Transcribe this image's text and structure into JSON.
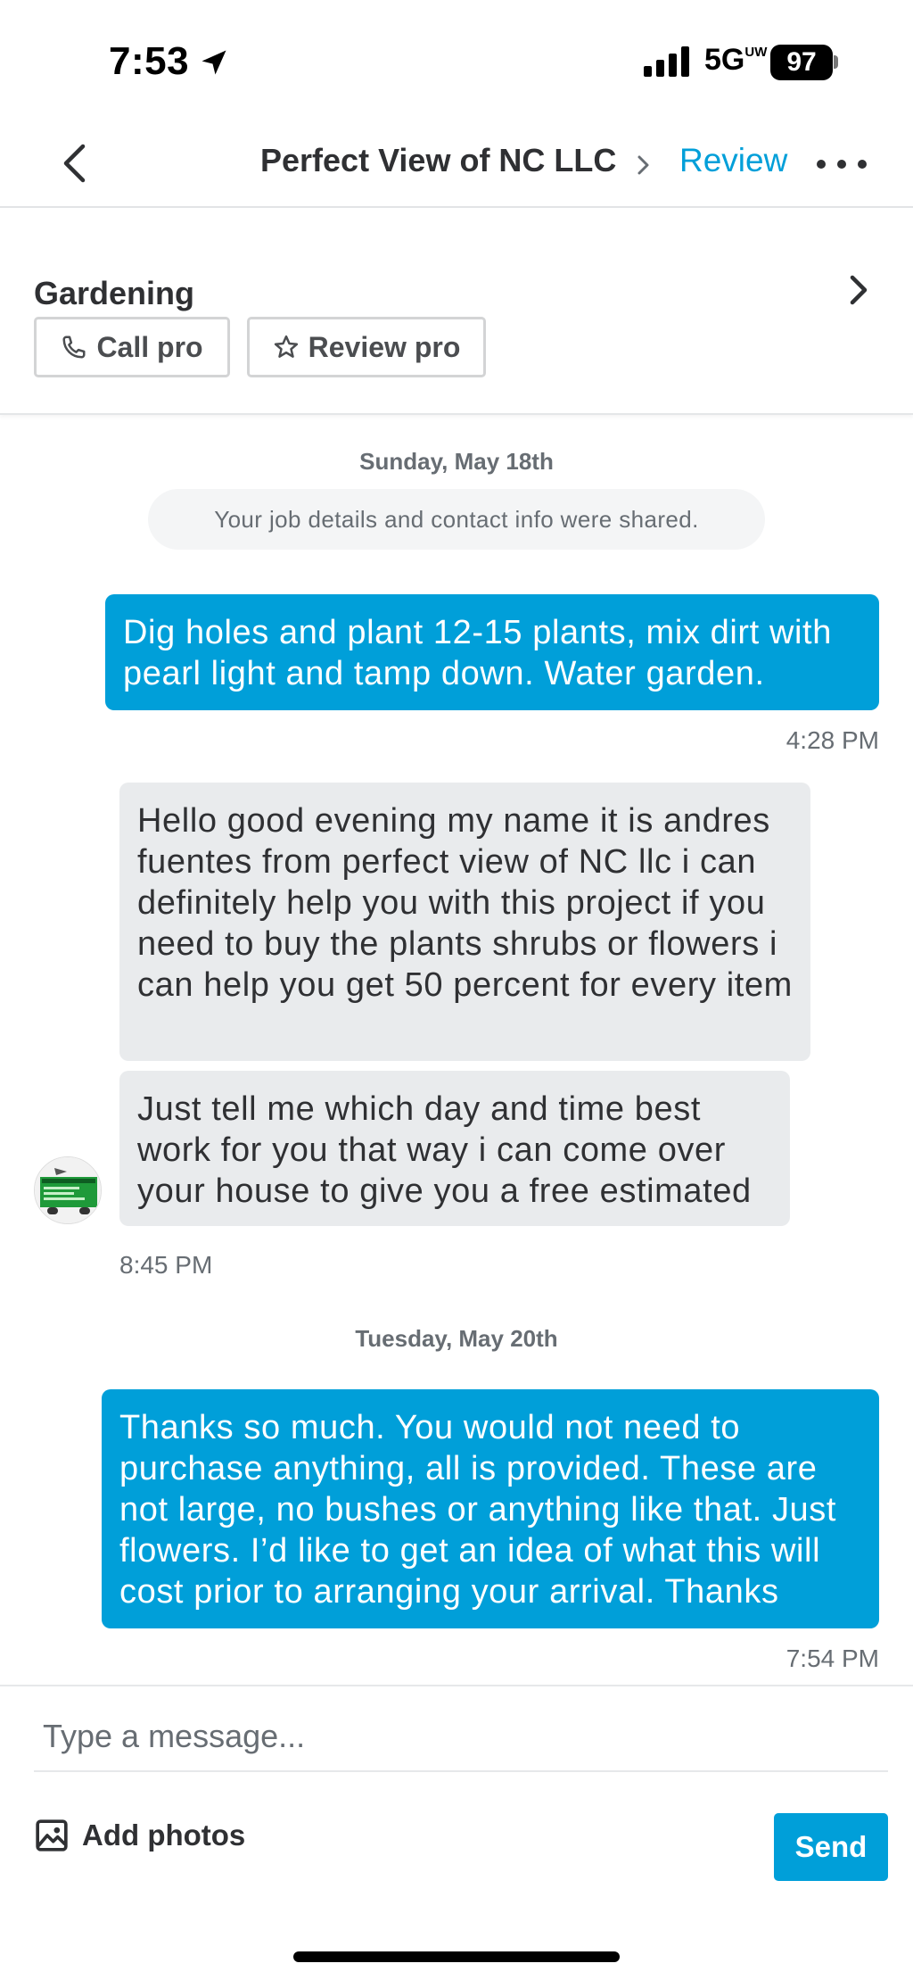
{
  "status_bar": {
    "time": "7:53",
    "network": "5G",
    "network_sub": "UW",
    "battery": "97"
  },
  "nav": {
    "title": "Perfect View of NC LLC",
    "review_label": "Review"
  },
  "job": {
    "title": "Gardening",
    "call_label": "Call pro",
    "review_label": "Review pro"
  },
  "chat": {
    "date_1": "Sunday, May 18th",
    "system_message": "Your job details and contact info were shared.",
    "msg_1": "Dig holes and plant 12-15 plants, mix dirt with pearl light and tamp down. Water garden.",
    "time_1": "4:28 PM",
    "msg_2": "Hello good evening my name it is andres fuentes from perfect view of NC llc i can definitely help you with this project if you need to buy the plants shrubs or flowers i can help you get 50 percent for every item",
    "msg_3": "Just tell me which day and time best work for you that way i can come over your house to give you a free estimated",
    "time_2": "8:45 PM",
    "date_2": "Tuesday, May 20th",
    "msg_4": "Thanks so much. You would not need to purchase anything, all is provided. These are not large, no bushes or anything like that. Just flowers. I’d like to get an idea of what this will cost prior to arranging your arrival. Thanks",
    "time_3": "7:54 PM"
  },
  "composer": {
    "placeholder": "Type a message...",
    "add_photos_label": "Add photos",
    "send_label": "Send"
  },
  "colors": {
    "accent": "#009fd9",
    "incoming_bubble": "#e9ebed",
    "text": "#2f3033",
    "muted": "#676d73"
  },
  "icons": [
    "location-arrow-icon",
    "signal-icon",
    "back-chevron-icon",
    "chevron-right-icon",
    "more-icon",
    "phone-icon",
    "star-icon",
    "image-icon"
  ]
}
